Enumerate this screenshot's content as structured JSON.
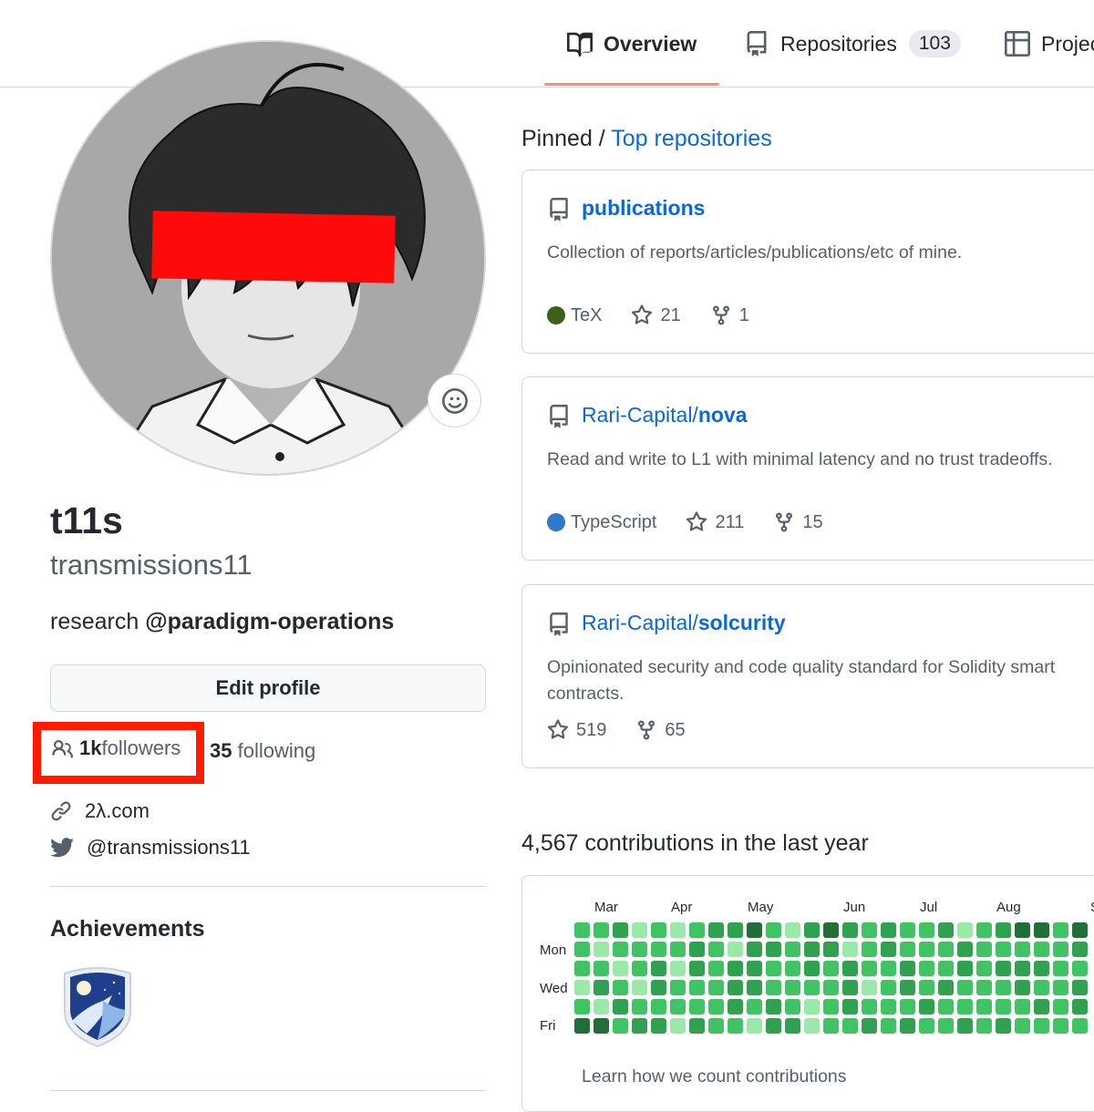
{
  "nav": {
    "tabs": [
      {
        "label": "Overview",
        "selected": true,
        "icon": "book-icon"
      },
      {
        "label": "Repositories",
        "count": "103",
        "icon": "repo-icon"
      },
      {
        "label": "Projec",
        "icon": "table-icon"
      }
    ]
  },
  "profile": {
    "name": "t11s",
    "login": "transmissions11",
    "bio_prefix": "research ",
    "bio_org": "@paradigm-operations",
    "edit_label": "Edit profile",
    "followers_count": "1k",
    "followers_label": " followers",
    "following_count": "35",
    "following_label": " following",
    "website": "2λ.com",
    "twitter": "@transmissions11"
  },
  "achievements": {
    "title": "Achievements"
  },
  "pinned": {
    "title_prefix": "Pinned / ",
    "title_link": "Top repositories",
    "repos": [
      {
        "owner": "",
        "name": "publications",
        "description": "Collection of reports/articles/publications/etc of mine.",
        "language": "TeX",
        "language_color": "#3d6117",
        "stars": "21",
        "forks": "1"
      },
      {
        "owner": "Rari-Capital/",
        "name": "nova",
        "description": "Read and write to L1 with minimal latency and no trust tradeoffs.",
        "language": "TypeScript",
        "language_color": "#3178c6",
        "stars": "211",
        "forks": "15"
      },
      {
        "owner": "Rari-Capital/",
        "name": "solcurity",
        "description": "Opinionated security and code quality standard for Solidity smart contracts.",
        "language": "",
        "language_color": "",
        "stars": "519",
        "forks": "65"
      }
    ]
  },
  "contributions": {
    "title": "4,567 contributions in the last year",
    "months": [
      "Mar",
      "Apr",
      "May",
      "Jun",
      "Jul",
      "Aug",
      "S"
    ],
    "days": [
      "Mon",
      "Wed",
      "Fri"
    ],
    "learn_link": "Learn how we count contributions",
    "levels": [
      [
        2,
        2,
        2,
        1,
        2,
        4
      ],
      [
        2,
        1,
        2,
        3,
        1,
        4
      ],
      [
        3,
        2,
        1,
        2,
        3,
        2
      ],
      [
        1,
        2,
        2,
        1,
        2,
        3
      ],
      [
        2,
        2,
        3,
        3,
        2,
        3
      ],
      [
        1,
        2,
        1,
        2,
        2,
        1
      ],
      [
        2,
        3,
        3,
        2,
        2,
        3
      ],
      [
        3,
        2,
        2,
        2,
        2,
        2
      ],
      [
        3,
        1,
        3,
        3,
        3,
        2
      ],
      [
        4,
        3,
        3,
        3,
        2,
        1
      ],
      [
        2,
        3,
        2,
        2,
        3,
        3
      ],
      [
        1,
        2,
        2,
        2,
        2,
        3
      ],
      [
        3,
        3,
        3,
        2,
        1,
        1
      ],
      [
        4,
        3,
        2,
        2,
        2,
        2
      ],
      [
        3,
        1,
        3,
        3,
        3,
        2
      ],
      [
        2,
        2,
        2,
        1,
        2,
        3
      ],
      [
        3,
        3,
        2,
        2,
        2,
        2
      ],
      [
        2,
        2,
        3,
        3,
        2,
        3
      ],
      [
        2,
        2,
        2,
        2,
        3,
        2
      ],
      [
        3,
        2,
        2,
        3,
        2,
        2
      ],
      [
        1,
        3,
        3,
        2,
        2,
        3
      ],
      [
        2,
        2,
        2,
        2,
        2,
        2
      ],
      [
        3,
        2,
        3,
        2,
        2,
        3
      ],
      [
        4,
        2,
        3,
        3,
        2,
        2
      ],
      [
        4,
        2,
        3,
        2,
        3,
        2
      ],
      [
        2,
        2,
        2,
        2,
        2,
        2
      ],
      [
        4,
        3,
        2,
        3,
        3,
        2
      ],
      [
        3,
        3,
        2,
        2,
        2,
        2
      ],
      [
        2,
        2,
        3,
        4,
        2,
        3
      ],
      [
        3,
        3,
        2,
        2,
        2,
        2
      ],
      [
        2,
        2,
        2,
        4,
        2,
        2
      ]
    ]
  },
  "colors": {
    "accent": "#0969da",
    "tab_underline": "#fd8c73",
    "highlight": "#ff1a00",
    "redaction": "#ff0a0a",
    "contrib_levels": [
      "#ebedf0",
      "#9be9a8",
      "#40c463",
      "#30a14e",
      "#216e39"
    ]
  }
}
